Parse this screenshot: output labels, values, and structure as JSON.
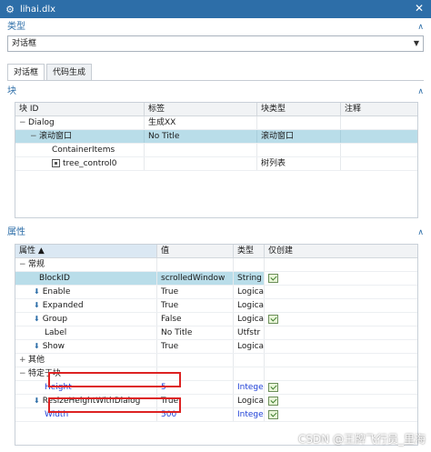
{
  "window": {
    "title": "lihai.dlx"
  },
  "type_section": {
    "heading": "类型",
    "selected_value": "对话框"
  },
  "tabs": [
    {
      "label": "对话框",
      "active": true
    },
    {
      "label": "代码生成",
      "active": false
    }
  ],
  "blocks": {
    "heading": "块",
    "columns": [
      "块 ID",
      "标签",
      "块类型",
      "注释"
    ],
    "rows": [
      {
        "id": "Dialog",
        "label": "生成XX",
        "type": "",
        "note": "",
        "expander": "−",
        "indent": 0,
        "selected": false
      },
      {
        "id": "滚动窗口",
        "label": "No Title",
        "type": "滚动窗口",
        "note": "",
        "expander": "−",
        "indent": 1,
        "selected": true
      },
      {
        "id": "ContainerItems",
        "label": "",
        "type": "",
        "note": "",
        "expander": "",
        "indent": 2,
        "selected": false
      },
      {
        "id": "tree_control0",
        "label": "",
        "type": "树列表",
        "note": "",
        "expander": "",
        "indent": 2,
        "selected": false,
        "icon": "tree-control-icon"
      }
    ]
  },
  "properties": {
    "heading": "属性",
    "columns": [
      "属性",
      "值",
      "类型",
      "仅创建"
    ],
    "rows": [
      {
        "name": "常规",
        "value": "",
        "type": "",
        "group": true,
        "expander": "−"
      },
      {
        "name": "BlockID",
        "value": "scrolledWindow",
        "type": "String",
        "create_only": true,
        "selected": true
      },
      {
        "name": "Enable",
        "value": "True",
        "type": "Logical",
        "create_only": false,
        "arrow": true
      },
      {
        "name": "Expanded",
        "value": "True",
        "type": "Logical",
        "create_only": false,
        "arrow": true
      },
      {
        "name": "Group",
        "value": "False",
        "type": "Logical",
        "create_only": true,
        "arrow": true
      },
      {
        "name": "Label",
        "value": "No Title",
        "type": "Utfstr",
        "create_only": false
      },
      {
        "name": "Show",
        "value": "True",
        "type": "Logical",
        "create_only": false,
        "arrow": true
      },
      {
        "name": "其他",
        "value": "",
        "type": "",
        "group": true,
        "expander": "+"
      },
      {
        "name": "特定于块",
        "value": "",
        "type": "",
        "group": true,
        "expander": "−"
      },
      {
        "name": "Height",
        "value": "5",
        "type": "Integer",
        "create_only": true,
        "blue": true
      },
      {
        "name": "ResizeHeightWithDialog",
        "value": "True",
        "type": "Logical",
        "create_only": true,
        "arrow": true
      },
      {
        "name": "Width",
        "value": "500",
        "type": "Integer",
        "create_only": true,
        "blue": true
      }
    ]
  },
  "watermark": "CSDN @王牌飞行员_里海",
  "colors": {
    "title_bar": "#2d6ea8",
    "selection": "#b9dde9",
    "highlight_box": "#d22222",
    "blue_text": "#1d3fd6"
  }
}
